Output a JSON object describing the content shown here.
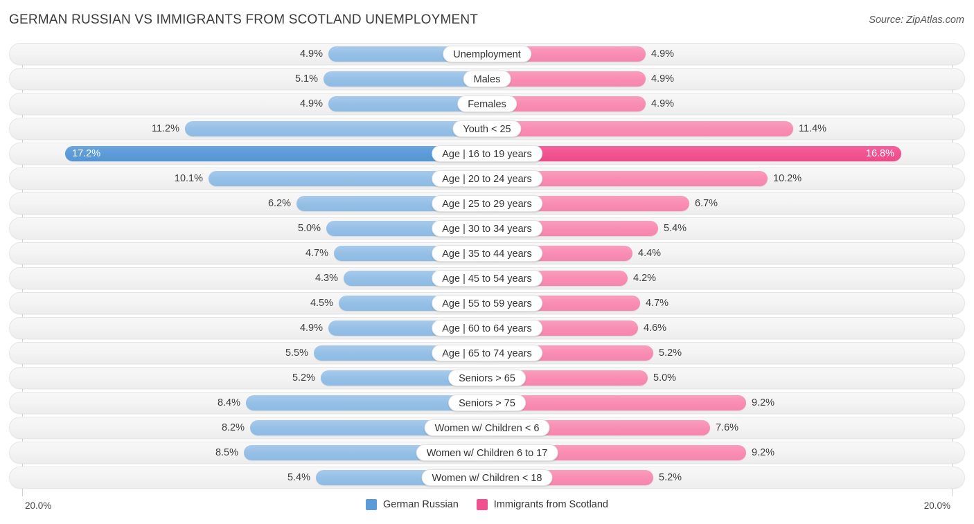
{
  "header": {
    "title": "GERMAN RUSSIAN VS IMMIGRANTS FROM SCOTLAND UNEMPLOYMENT",
    "source": "Source: ZipAtlas.com"
  },
  "footer": {
    "axis_left": "20.0%",
    "axis_right": "20.0%"
  },
  "legend": {
    "items": [
      {
        "label": "German Russian",
        "color": "#5b9bd8",
        "swatch_name": "legend-swatch-german-russian"
      },
      {
        "label": "Immigrants from Scotland",
        "color": "#f1518f",
        "swatch_name": "legend-swatch-immigrants-scotland"
      }
    ]
  },
  "colors": {
    "left_bar": "#94bfe6",
    "right_bar": "#f88cb2",
    "left_bar_max": "#5b9bd8",
    "right_bar_max": "#f1518f",
    "track": "#f4f4f4",
    "axis": "#d2d2d2"
  },
  "chart_data": {
    "type": "bar",
    "orientation": "horizontal-diverging",
    "title": "GERMAN RUSSIAN VS IMMIGRANTS FROM SCOTLAND UNEMPLOYMENT",
    "xlabel": "",
    "ylabel": "",
    "axis_max": 20.0,
    "axis_unit": "%",
    "xlim": [
      20.0,
      20.0
    ],
    "grid": false,
    "legend_position": "bottom-center",
    "categories": [
      "Unemployment",
      "Males",
      "Females",
      "Youth < 25",
      "Age | 16 to 19 years",
      "Age | 20 to 24 years",
      "Age | 25 to 29 years",
      "Age | 30 to 34 years",
      "Age | 35 to 44 years",
      "Age | 45 to 54 years",
      "Age | 55 to 59 years",
      "Age | 60 to 64 years",
      "Age | 65 to 74 years",
      "Seniors > 65",
      "Seniors > 75",
      "Women w/ Children < 6",
      "Women w/ Children 6 to 17",
      "Women w/ Children < 18"
    ],
    "series": [
      {
        "name": "German Russian",
        "side": "left",
        "color": "#94bfe6",
        "values": [
          4.9,
          5.1,
          4.9,
          11.2,
          17.2,
          10.1,
          6.2,
          5.0,
          4.7,
          4.3,
          4.5,
          4.9,
          5.5,
          5.2,
          8.4,
          8.2,
          8.5,
          5.4
        ],
        "labels": [
          "4.9%",
          "5.1%",
          "4.9%",
          "11.2%",
          "17.2%",
          "10.1%",
          "6.2%",
          "5.0%",
          "4.7%",
          "4.3%",
          "4.5%",
          "4.9%",
          "5.5%",
          "5.2%",
          "8.4%",
          "8.2%",
          "8.5%",
          "5.4%"
        ]
      },
      {
        "name": "Immigrants from Scotland",
        "side": "right",
        "color": "#f88cb2",
        "values": [
          4.9,
          4.9,
          4.9,
          11.4,
          16.8,
          10.2,
          6.7,
          5.4,
          4.4,
          4.2,
          4.7,
          4.6,
          5.2,
          5.0,
          9.2,
          7.6,
          9.2,
          5.2
        ],
        "labels": [
          "4.9%",
          "4.9%",
          "4.9%",
          "11.4%",
          "16.8%",
          "10.2%",
          "6.7%",
          "5.4%",
          "4.4%",
          "4.2%",
          "4.7%",
          "4.6%",
          "5.2%",
          "5.0%",
          "9.2%",
          "7.6%",
          "9.2%",
          "5.2%"
        ]
      }
    ],
    "highlight_row_index": 4
  }
}
